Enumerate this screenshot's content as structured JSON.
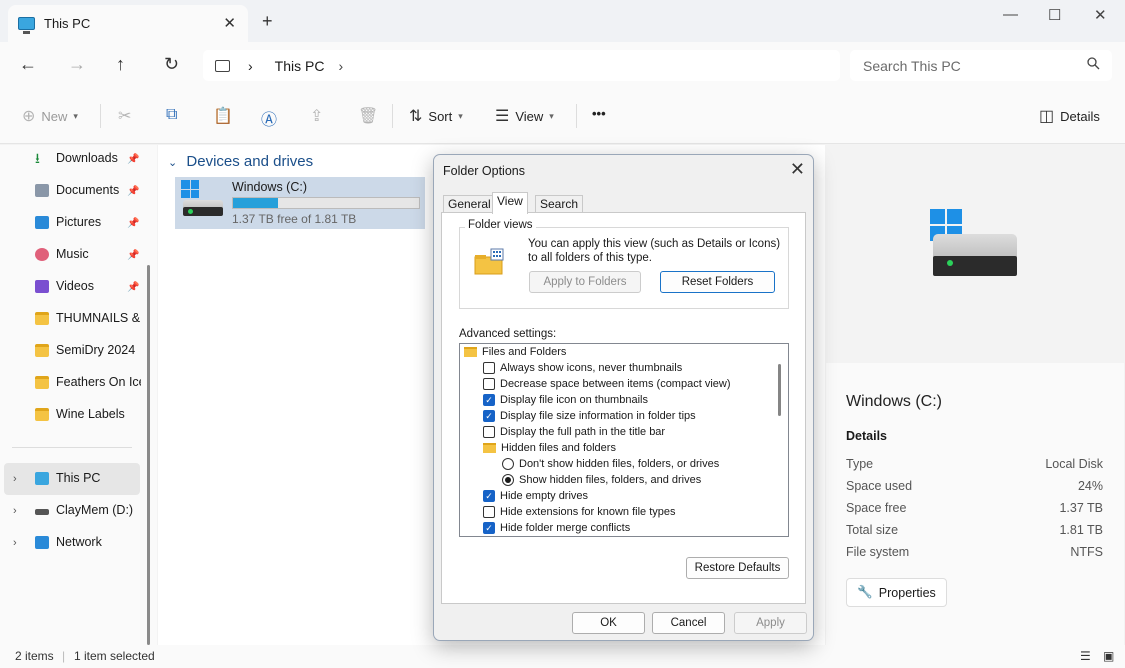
{
  "window": {
    "tab_title": "This PC",
    "tab_close": "✕",
    "new_tab": "+",
    "minimize": "—",
    "maximize": "☐",
    "close": "✕"
  },
  "nav": {
    "back": "←",
    "forward": "→",
    "up": "↑",
    "refresh": "↻",
    "breadcrumb": [
      "This PC"
    ],
    "breadcrumb_sep": "›",
    "search_placeholder": "Search This PC"
  },
  "toolbar": {
    "new_label": "New",
    "sort_label": "Sort",
    "view_label": "View",
    "more_label": "•••",
    "details_label": "Details"
  },
  "sidebar": {
    "quick_access": [
      {
        "label": "Downloads",
        "icon": "downloads-icon",
        "pinned": true
      },
      {
        "label": "Documents",
        "icon": "documents-icon",
        "pinned": true
      },
      {
        "label": "Pictures",
        "icon": "pictures-icon",
        "pinned": true
      },
      {
        "label": "Music",
        "icon": "music-icon",
        "pinned": true
      },
      {
        "label": "Videos",
        "icon": "videos-icon",
        "pinned": true
      },
      {
        "label": "THUMNAILS & T",
        "icon": "folder-icon",
        "pinned": false
      },
      {
        "label": "SemiDry 2024",
        "icon": "folder-icon",
        "pinned": false
      },
      {
        "label": "Feathers On Ice",
        "icon": "folder-icon",
        "pinned": false
      },
      {
        "label": "Wine Labels",
        "icon": "folder-icon",
        "pinned": false
      }
    ],
    "locations": [
      {
        "label": "This PC",
        "selected": true
      },
      {
        "label": "ClayMem (D:)",
        "selected": false
      },
      {
        "label": "Network",
        "selected": false
      }
    ]
  },
  "content": {
    "group_title": "Devices and drives",
    "drive": {
      "name": "Windows (C:)",
      "free_text": "1.37 TB free of 1.81 TB",
      "used_fraction": 0.24
    }
  },
  "details_pane": {
    "name": "Windows (C:)",
    "heading": "Details",
    "rows": [
      {
        "key": "Type",
        "value": "Local Disk"
      },
      {
        "key": "Space used",
        "value": "24%"
      },
      {
        "key": "Space free",
        "value": "1.37 TB"
      },
      {
        "key": "Total size",
        "value": "1.81 TB"
      },
      {
        "key": "File system",
        "value": "NTFS"
      }
    ],
    "properties_label": "Properties"
  },
  "status": {
    "items_count": "2 items",
    "selected": "1 item selected"
  },
  "dialog": {
    "title": "Folder Options",
    "close": "✕",
    "tabs": [
      "General",
      "View",
      "Search"
    ],
    "active_tab": "View",
    "folder_views_legend": "Folder views",
    "folder_views_text": "You can apply this view (such as Details or Icons) to all folders of this type.",
    "apply_to_folders": "Apply to Folders",
    "reset_folders": "Reset Folders",
    "advanced_label": "Advanced settings:",
    "advanced_items": [
      {
        "type": "folder",
        "label": "Files and Folders",
        "indent": 0
      },
      {
        "type": "checkbox",
        "label": "Always show icons, never thumbnails",
        "checked": false,
        "indent": 1
      },
      {
        "type": "checkbox",
        "label": "Decrease space between items (compact view)",
        "checked": false,
        "indent": 1
      },
      {
        "type": "checkbox",
        "label": "Display file icon on thumbnails",
        "checked": true,
        "indent": 1
      },
      {
        "type": "checkbox",
        "label": "Display file size information in folder tips",
        "checked": true,
        "indent": 1
      },
      {
        "type": "checkbox",
        "label": "Display the full path in the title bar",
        "checked": false,
        "indent": 1
      },
      {
        "type": "folder",
        "label": "Hidden files and folders",
        "indent": 1
      },
      {
        "type": "radio",
        "label": "Don't show hidden files, folders, or drives",
        "checked": false,
        "indent": 2
      },
      {
        "type": "radio",
        "label": "Show hidden files, folders, and drives",
        "checked": true,
        "indent": 2
      },
      {
        "type": "checkbox",
        "label": "Hide empty drives",
        "checked": true,
        "indent": 1
      },
      {
        "type": "checkbox",
        "label": "Hide extensions for known file types",
        "checked": false,
        "indent": 1
      },
      {
        "type": "checkbox",
        "label": "Hide folder merge conflicts",
        "checked": true,
        "indent": 1
      }
    ],
    "restore_defaults": "Restore Defaults",
    "ok": "OK",
    "cancel": "Cancel",
    "apply": "Apply"
  },
  "colors": {
    "accent": "#1663c7",
    "drive_bar": "#26a0da",
    "selection": "#ccd9e8",
    "folder": "#f4c343"
  }
}
